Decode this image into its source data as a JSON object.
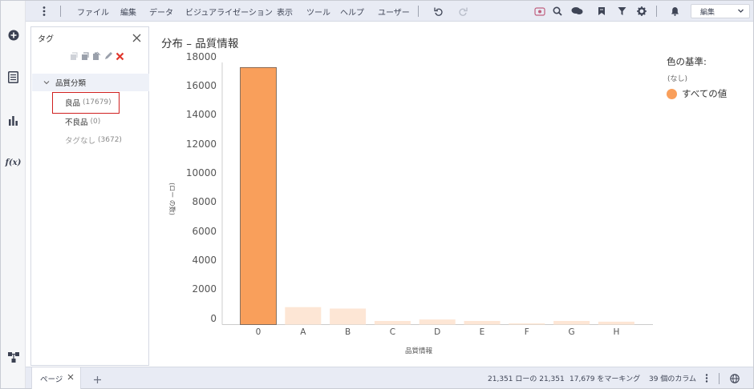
{
  "toolbar": {
    "menus": [
      "ファイル",
      "編集",
      "データ",
      "ビジュアライゼーション",
      "表示",
      "ツール",
      "ヘルプ",
      "ユーザー"
    ],
    "mode": "編集",
    "icons": [
      "more-vert-icon",
      "undo-icon",
      "redo-icon",
      "recommendations-icon",
      "search-icon",
      "comment-icon",
      "bookmark-icon",
      "filter-icon",
      "gear-icon",
      "bell-icon",
      "chevron-down-icon"
    ]
  },
  "rail": {
    "icons": [
      "add-icon",
      "data-table-icon",
      "bar-chart-icon",
      "fx-icon",
      "hierarchy-icon"
    ]
  },
  "tags_panel": {
    "title": "タグ",
    "tree_root": "品質分類",
    "items": [
      {
        "label": "良品",
        "count": "(17679)",
        "highlighted": true
      },
      {
        "label": "不良品",
        "count": "(0)"
      },
      {
        "label": "タグなし",
        "count": "(3672)",
        "dim": true
      }
    ],
    "tools": [
      "add-tag-collection-icon",
      "copy-icon",
      "paste-icon",
      "pencil-icon",
      "delete-icon"
    ]
  },
  "chart": {
    "title": "分布 – 品質情報",
    "legend_title": "色の基準:",
    "legend_sub": "(なし)",
    "legend_item": "すべての値",
    "x_axis_label": "品質情報",
    "y_axis_label": "(ロー の数)",
    "colors": {
      "marked": "#f99f5b",
      "faded": "#fde6d5",
      "stroke": "#6a5a50"
    }
  },
  "chart_data": {
    "type": "bar",
    "title": "分布 – 品質情報",
    "xlabel": "品質情報",
    "ylabel": "(ロー の数)",
    "categories": [
      "0",
      "A",
      "B",
      "C",
      "D",
      "E",
      "F",
      "G",
      "H"
    ],
    "series": [
      {
        "name": "すべての値",
        "values": [
          17679,
          1200,
          1100,
          250,
          350,
          250,
          80,
          250,
          200
        ]
      }
    ],
    "marked": [
      true,
      false,
      false,
      false,
      false,
      false,
      false,
      false,
      false
    ],
    "y_ticks": [
      "18000",
      "16000",
      "14000",
      "12000",
      "10000",
      "8000",
      "6000",
      "4000",
      "2000",
      "0"
    ],
    "ylim": [
      0,
      18000
    ],
    "grid": false,
    "legend_position": "top-right"
  },
  "statusbar": {
    "page_tab": "ページ",
    "rows": "21,351 ローの 21,351",
    "marked": "17,679 をマーキング",
    "columns": "39 個のカラム"
  }
}
